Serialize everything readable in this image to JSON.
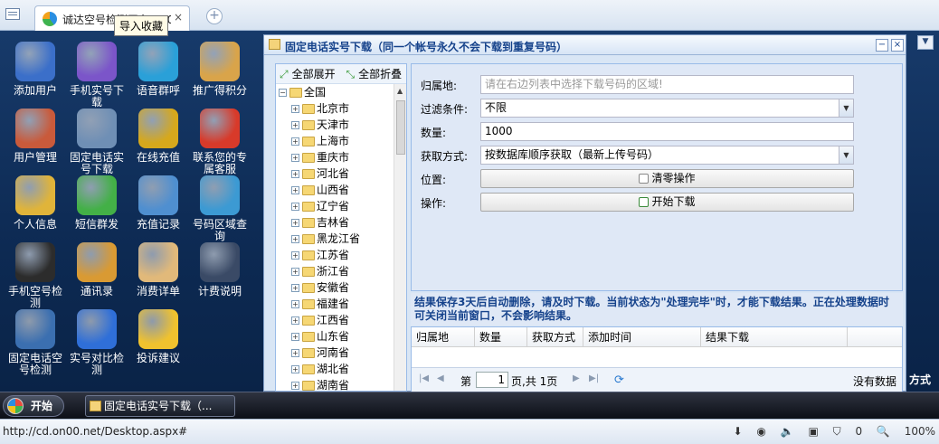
{
  "browser": {
    "tab_title": "诚达空号检测平台V3.00",
    "tooltip": "导入收藏",
    "new_tab": "+",
    "close": "×"
  },
  "desktop_icons": [
    {
      "label": "添加用户",
      "icon": "users-icon",
      "color": "#3b6fc9"
    },
    {
      "label": "手机实号下载",
      "icon": "mobile-phone-icon",
      "color": "#7b55c9"
    },
    {
      "label": "语音群呼",
      "icon": "call-icon",
      "color": "#2aa0d8"
    },
    {
      "label": "推广得积分",
      "icon": "promotion-icon",
      "color": "#d9a44a"
    },
    {
      "label": "用户管理",
      "icon": "user-admin-icon",
      "color": "#c95a3b"
    },
    {
      "label": "固定电话实号下载",
      "icon": "landline-icon",
      "color": "#6f8fb5"
    },
    {
      "label": "在线充值",
      "icon": "coins-icon",
      "color": "#d6a81c"
    },
    {
      "label": "联系您的专属客服",
      "icon": "service-phone-icon",
      "color": "#d83a2a"
    },
    {
      "label": "个人信息",
      "icon": "key-icon",
      "color": "#e0b43a"
    },
    {
      "label": "短信群发",
      "icon": "sms-icon",
      "color": "#43b047"
    },
    {
      "label": "充值记录",
      "icon": "card-icon",
      "color": "#4f8fd0"
    },
    {
      "label": "号码区域查询",
      "icon": "map-search-icon",
      "color": "#3c9ad3"
    },
    {
      "label": "手机空号检测",
      "icon": "phone-check-icon",
      "color": "#2c2c2c"
    },
    {
      "label": "通讯录",
      "icon": "address-book-icon",
      "color": "#d99a33"
    },
    {
      "label": "消费详单",
      "icon": "bill-icon",
      "color": "#e1b97a"
    },
    {
      "label": "计费说明",
      "icon": "billing-info-icon",
      "color": "#3a4a66"
    },
    {
      "label": "固定电话空号检测",
      "icon": "landline-check-icon",
      "color": "#3b6fb0"
    },
    {
      "label": "实号对比检测",
      "icon": "magnifier-icon",
      "color": "#2f6fd8"
    },
    {
      "label": "投诉建议",
      "icon": "envelope-icon",
      "color": "#f0c22e"
    }
  ],
  "window": {
    "title": "固定电话实号下载（同一个帐号永久不会下载到重复号码）",
    "min": "−",
    "close": "×",
    "tree": {
      "expand_all": "全部展开",
      "collapse_all": "全部折叠",
      "root": "全国",
      "items": [
        "北京市",
        "天津市",
        "上海市",
        "重庆市",
        "河北省",
        "山西省",
        "辽宁省",
        "吉林省",
        "黑龙江省",
        "江苏省",
        "浙江省",
        "安徽省",
        "福建省",
        "江西省",
        "山东省",
        "河南省",
        "湖北省",
        "湖南省"
      ]
    },
    "form": {
      "region_label": "归属地:",
      "region_placeholder": "请在右边列表中选择下载号码的区域!",
      "filter_label": "过滤条件:",
      "filter_value": "不限",
      "count_label": "数量:",
      "count_value": "1000",
      "method_label": "获取方式:",
      "method_value": "按数据库顺序获取（最新上传号码）",
      "position_label": "位置:",
      "clear_button": "清零操作",
      "action_label": "操作:",
      "download_button": "开始下载"
    },
    "note": "结果保存3天后自动删除，请及时下载。当前状态为\"处理完毕\"时，才能下载结果。正在处理数据时可关闭当前窗口，不会影响结果。",
    "grid": {
      "columns": [
        "归属地",
        "数量",
        "获取方式",
        "添加时间",
        "结果下载"
      ],
      "pager": {
        "page_prefix": "第",
        "page": "1",
        "page_suffix": "页,共 1页",
        "empty": "没有数据"
      }
    }
  },
  "right_text": "方式",
  "taskbar": {
    "start": "开始",
    "item": "固定电话实号下载（..."
  },
  "status": {
    "url": "http://cd.on00.net/Desktop.aspx#",
    "shield_count": "0",
    "zoom": "100%"
  }
}
